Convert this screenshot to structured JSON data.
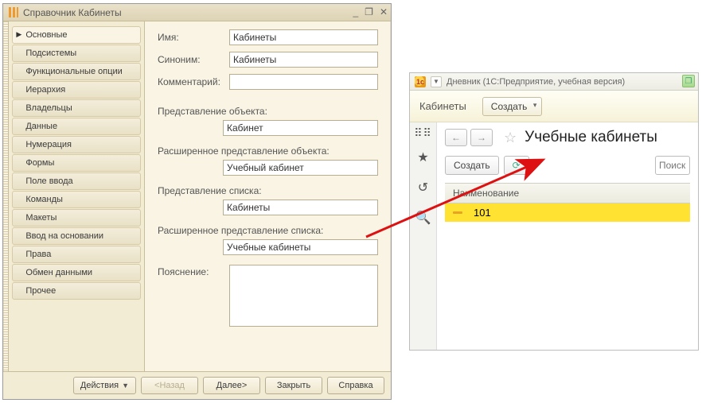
{
  "designer": {
    "title": "Справочник Кабинеты",
    "nav": [
      "Основные",
      "Подсистемы",
      "Функциональные опции",
      "Иерархия",
      "Владельцы",
      "Данные",
      "Нумерация",
      "Формы",
      "Поле ввода",
      "Команды",
      "Макеты",
      "Ввод на основании",
      "Права",
      "Обмен данными",
      "Прочее"
    ],
    "nav_selected_index": 0,
    "labels": {
      "name": "Имя:",
      "synonym": "Синоним:",
      "comment": "Комментарий:",
      "obj_repr": "Представление объекта:",
      "obj_repr_ext": "Расширенное представление объекта:",
      "list_repr": "Представление списка:",
      "list_repr_ext": "Расширенное представление списка:",
      "explanation": "Пояснение:"
    },
    "values": {
      "name": "Кабинеты",
      "synonym": "Кабинеты",
      "comment": "",
      "obj_repr": "Кабинет",
      "obj_repr_ext": "Учебный кабинет",
      "list_repr": "Кабинеты",
      "list_repr_ext": "Учебные кабинеты",
      "explanation": ""
    },
    "footer": {
      "actions": "Действия",
      "back": "<Назад",
      "next": "Далее>",
      "close": "Закрыть",
      "help": "Справка"
    }
  },
  "runtime": {
    "title": "Дневник  (1С:Предприятие, учебная версия)",
    "breadcrumb": "Кабинеты",
    "create": "Создать",
    "page_title": "Учебные кабинеты",
    "create2": "Создать",
    "search_placeholder": "Поиск",
    "grid_header": "Наименование",
    "rows": [
      {
        "name": "101"
      }
    ]
  }
}
